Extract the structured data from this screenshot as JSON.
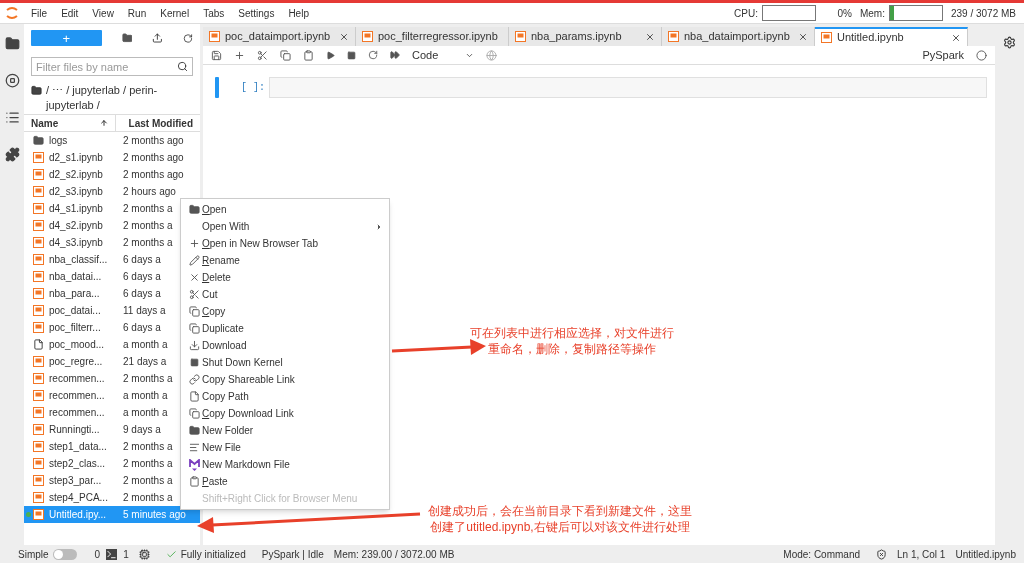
{
  "menubar": {
    "items": [
      "File",
      "Edit",
      "View",
      "Run",
      "Kernel",
      "Tabs",
      "Settings",
      "Help"
    ],
    "cpu": {
      "label": "CPU:",
      "reading": "0%"
    },
    "mem": {
      "label": "Mem:",
      "reading": "239 / 3072 MB",
      "level": 0.08
    }
  },
  "file_browser": {
    "new_button": "+",
    "filter": {
      "placeholder": "Filter files by name"
    },
    "breadcrumb": "/  ⋯  / jupyterlab / perin-jupyterlab /",
    "columns": [
      {
        "label": "Name",
        "sorted": true
      },
      {
        "label": "Last Modified",
        "sorted": false
      }
    ],
    "rows": [
      {
        "kind": "folder",
        "name": "logs",
        "modified": "2 months ago",
        "selected": false,
        "running": false
      },
      {
        "kind": "notebook",
        "name": "d2_s1.ipynb",
        "modified": "2 months ago",
        "selected": false,
        "running": false
      },
      {
        "kind": "notebook",
        "name": "d2_s2.ipynb",
        "modified": "2 months ago",
        "selected": false,
        "running": false
      },
      {
        "kind": "notebook",
        "name": "d2_s3.ipynb",
        "modified": "2 hours ago",
        "selected": false,
        "running": false
      },
      {
        "kind": "notebook",
        "name": "d4_s1.ipynb",
        "modified": "2 months a",
        "selected": false,
        "running": false
      },
      {
        "kind": "notebook",
        "name": "d4_s2.ipynb",
        "modified": "2 months a",
        "selected": false,
        "running": false
      },
      {
        "kind": "notebook",
        "name": "d4_s3.ipynb",
        "modified": "2 months a",
        "selected": false,
        "running": false
      },
      {
        "kind": "notebook",
        "name": "nba_classif...",
        "modified": "6 days a",
        "selected": false,
        "running": false
      },
      {
        "kind": "notebook",
        "name": "nba_datai...",
        "modified": "6 days a",
        "selected": false,
        "running": false
      },
      {
        "kind": "notebook",
        "name": "nba_para...",
        "modified": "6 days a",
        "selected": false,
        "running": false
      },
      {
        "kind": "notebook",
        "name": "poc_datai...",
        "modified": "11 days a",
        "selected": false,
        "running": false
      },
      {
        "kind": "notebook",
        "name": "poc_filterr...",
        "modified": "6 days a",
        "selected": false,
        "running": false
      },
      {
        "kind": "file",
        "name": "poc_mood...",
        "modified": "a month a",
        "selected": false,
        "running": false
      },
      {
        "kind": "notebook",
        "name": "poc_regre...",
        "modified": "21 days a",
        "selected": false,
        "running": false
      },
      {
        "kind": "notebook",
        "name": "recommen...",
        "modified": "2 months a",
        "selected": false,
        "running": false
      },
      {
        "kind": "notebook",
        "name": "recommen...",
        "modified": "a month a",
        "selected": false,
        "running": false
      },
      {
        "kind": "notebook",
        "name": "recommen...",
        "modified": "a month a",
        "selected": false,
        "running": false
      },
      {
        "kind": "notebook",
        "name": "Runningti...",
        "modified": "9 days a",
        "selected": false,
        "running": false
      },
      {
        "kind": "notebook",
        "name": "step1_data...",
        "modified": "2 months a",
        "selected": false,
        "running": false
      },
      {
        "kind": "notebook",
        "name": "step2_clas...",
        "modified": "2 months a",
        "selected": false,
        "running": false
      },
      {
        "kind": "notebook",
        "name": "step3_par...",
        "modified": "2 months a",
        "selected": false,
        "running": false
      },
      {
        "kind": "notebook",
        "name": "step4_PCA...",
        "modified": "2 months a",
        "selected": false,
        "running": false
      },
      {
        "kind": "notebook",
        "name": "Untitled.ipy...",
        "modified": "5 minutes ago",
        "selected": true,
        "running": true
      }
    ]
  },
  "tabs": [
    {
      "label": "poc_dataimport.ipynb",
      "selected": false
    },
    {
      "label": "poc_filterregressor.ipynb",
      "selected": false
    },
    {
      "label": "nba_params.ipynb",
      "selected": false
    },
    {
      "label": "nba_dataimport.ipynb",
      "selected": false
    },
    {
      "label": "Untitled.ipynb",
      "selected": true
    }
  ],
  "notebook": {
    "cell_type": "Code",
    "kernel": "PySpark",
    "kernel_busy": false,
    "prompt": "[ ]:"
  },
  "context_menu": [
    {
      "label": "Open",
      "mnemonic": true,
      "submenu": false,
      "disabled": false
    },
    {
      "label": "Open With",
      "mnemonic": false,
      "submenu": true,
      "disabled": false
    },
    {
      "label": "Open in New Browser Tab",
      "mnemonic": true,
      "submenu": false,
      "disabled": false
    },
    {
      "label": "Rename",
      "mnemonic": true,
      "submenu": false,
      "disabled": false
    },
    {
      "label": "Delete",
      "mnemonic": true,
      "submenu": false,
      "disabled": false
    },
    {
      "label": "Cut",
      "mnemonic": false,
      "submenu": false,
      "disabled": false
    },
    {
      "label": "Copy",
      "mnemonic": true,
      "submenu": false,
      "disabled": false
    },
    {
      "label": "Duplicate",
      "mnemonic": false,
      "submenu": false,
      "disabled": false
    },
    {
      "label": "Download",
      "mnemonic": false,
      "submenu": false,
      "disabled": false
    },
    {
      "label": "Shut Down Kernel",
      "mnemonic": false,
      "submenu": false,
      "disabled": false
    },
    {
      "label": "Copy Shareable Link",
      "mnemonic": false,
      "submenu": false,
      "disabled": false
    },
    {
      "label": "Copy Path",
      "mnemonic": false,
      "submenu": false,
      "disabled": false
    },
    {
      "label": "Copy Download Link",
      "mnemonic": true,
      "submenu": false,
      "disabled": false
    },
    {
      "label": "New Folder",
      "mnemonic": false,
      "submenu": false,
      "disabled": false
    },
    {
      "label": "New File",
      "mnemonic": false,
      "submenu": false,
      "disabled": false
    },
    {
      "label": "New Markdown File",
      "mnemonic": false,
      "submenu": false,
      "disabled": false
    },
    {
      "label": "Paste",
      "mnemonic": true,
      "submenu": false,
      "disabled": false
    },
    {
      "label": "Shift+Right Click for Browser Menu",
      "mnemonic": false,
      "submenu": false,
      "disabled": true
    }
  ],
  "annotations": [
    {
      "lines": [
        "可在列表中进行相应选择，对文件进行",
        "重命名，删除，复制路径等操作"
      ]
    },
    {
      "lines": [
        "创建成功后，会在当前目录下看到新建文件，这里",
        "创建了utitled.ipynb,右键后可以对该文件进行处理"
      ]
    }
  ],
  "status_bar": {
    "simple_label": "Simple",
    "simple_on": false,
    "terminals": "0",
    "kernels": "1",
    "init": "Fully initialized",
    "kernel_state": "PySpark | Idle",
    "memory": "Mem: 239.00 / 3072.00 MB",
    "mode": "Mode: Command",
    "position": "Ln 1, Col 1",
    "file": "Untitled.ipynb"
  }
}
